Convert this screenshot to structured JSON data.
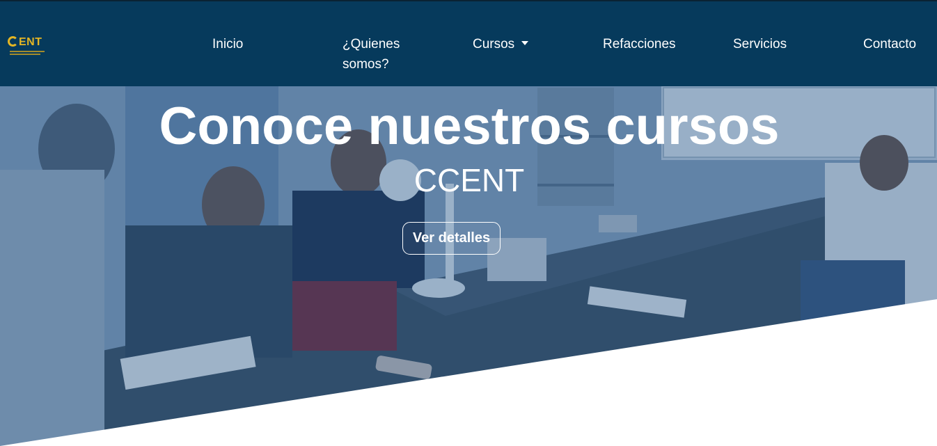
{
  "logo": {
    "brand": "ENT",
    "alt": "CCENT"
  },
  "nav": {
    "inicio": "Inicio",
    "quienes_line1": "¿Quienes",
    "quienes_line2": "somos?",
    "cursos": "Cursos",
    "refacciones": "Refacciones",
    "servicios": "Servicios",
    "contacto": "Contacto"
  },
  "hero": {
    "title": "Conoce nuestros cursos",
    "subtitle": "CCENT",
    "button": "Ver detalles"
  },
  "colors": {
    "navbar_bg": "#063a5c",
    "logo_gold": "#e3b524",
    "hero_overlay": "#14467a",
    "text": "#ffffff"
  },
  "icons": {
    "cursos_dropdown": "caret-down-icon"
  }
}
